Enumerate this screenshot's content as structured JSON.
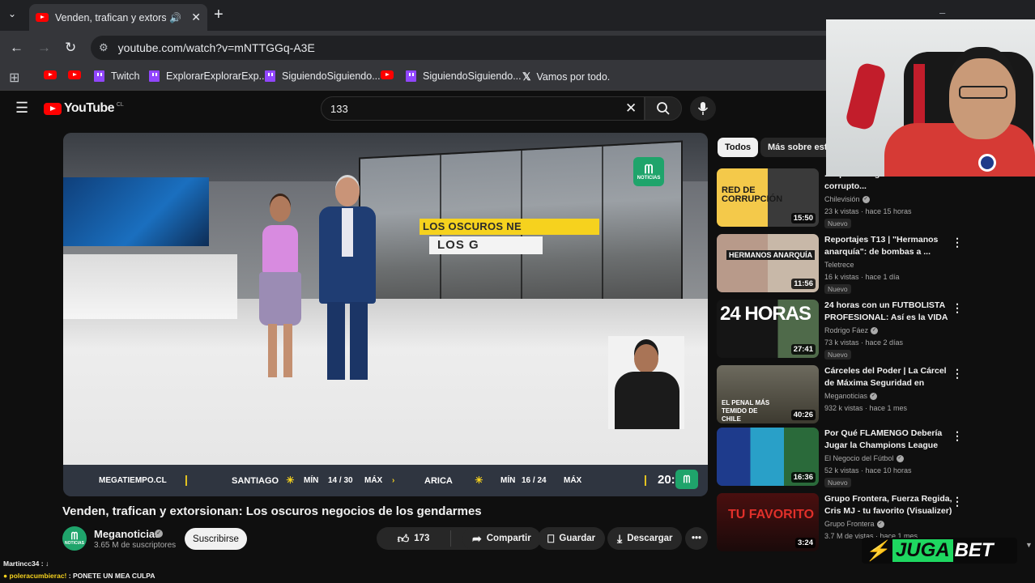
{
  "browser": {
    "tab_title": "Venden, trafican y extorsion",
    "url": "youtube.com/watch?v=mNTTGGq-A3E",
    "bookmarks": [
      {
        "label": "Twitch"
      },
      {
        "label": "ExplorarExplorarExp..."
      },
      {
        "label": "SiguiendoSiguiendo..."
      },
      {
        "label": "SiguiendoSiguiendo..."
      },
      {
        "label": "Vamos por todo."
      }
    ]
  },
  "youtube": {
    "logo_text": "YouTube",
    "country_code": "CL",
    "search_value": "133"
  },
  "video": {
    "banner_line1": "LOS OSCUROS NE",
    "banner_line2": "LOS G",
    "bug_text": "NOTICIAS",
    "weather_site": "MEGATIEMPO.CL",
    "city1": "SANTIAGO",
    "city1_min_label": "MÍN",
    "city1_values": "14 / 30",
    "city1_max_label": "MÁX",
    "city2": "ARICA",
    "city2_min_label": "MÍN",
    "city2_values": "16 / 24",
    "city2_max_label": "MÁX",
    "clock": "20:"
  },
  "watch": {
    "title": "Venden, trafican y extorsionan: Los oscuros negocios de los gendarmes",
    "channel": "Meganoticias",
    "channel_avatar_text": "NOTICIAS",
    "subscribers": "3.65 M de suscriptores",
    "subscribe_label": "Suscribirse",
    "likes": "173",
    "share_label": "Compartir",
    "save_label": "Guardar",
    "download_label": "Descargar"
  },
  "sidebar": {
    "chips": [
      "Todos",
      "Más sobre esta"
    ],
    "videos": [
      {
        "title": "... operaban gendarmes corrupto...",
        "channel": "Chilevisión",
        "meta": "23 k vistas · hace 15 horas",
        "badge": "Nuevo",
        "duration": "15:50",
        "thumb_text": "RED DE CORRUPCIÓN"
      },
      {
        "title": "Reportajes T13 | \"Hermanos anarquía\": de bombas a ...",
        "channel": "Teletrece",
        "meta": "16 k vistas · hace 1 día",
        "badge": "Nuevo",
        "duration": "11:56",
        "thumb_text": "HERMANOS ANARQUÍA"
      },
      {
        "title": "24 horas con un FUTBOLISTA PROFESIONAL: Así es la VIDA ...",
        "channel": "Rodrigo Fáez",
        "meta": "73 k vistas · hace 2 días",
        "badge": "Nuevo",
        "duration": "27:41",
        "thumb_text": "24 HORAS"
      },
      {
        "title": "Cárceles del Poder | La Cárcel de Máxima Seguridad en Chile...",
        "channel": "Meganoticias",
        "meta": "932 k vistas · hace 1 mes",
        "badge": "",
        "duration": "40:26",
        "thumb_text": "EL PENAL MÁS TEMIDO DE CHILE"
      },
      {
        "title": "Por Qué FLAMENGO Debería Jugar la Champions League",
        "channel": "El Negocio del Fútbol",
        "meta": "52 k vistas · hace 10 horas",
        "badge": "Nuevo",
        "duration": "16:36",
        "thumb_text": ""
      },
      {
        "title": "Grupo Frontera, Fuerza Regida, Cris MJ - tu favorito (Visualizer)",
        "channel": "Grupo Frontera",
        "meta": "3.7 M de vistas · hace 1 mes",
        "badge": "",
        "duration": "3:24",
        "thumb_text": "TU FAVORITO"
      }
    ]
  },
  "chat": [
    {
      "user": "Martincc34",
      "message": "↓",
      "color": "#ffffff"
    },
    {
      "user": "poleracumbierac!",
      "message": "PONETE UN MEA CULPA",
      "color": "#f6d21e"
    }
  ],
  "sponsor": {
    "part1": "JUGA",
    "part2": "BET"
  },
  "colors": {
    "accent_red": "#ff0000",
    "mega_green": "#1fa46b",
    "jugabet_green": "#1ed760"
  }
}
